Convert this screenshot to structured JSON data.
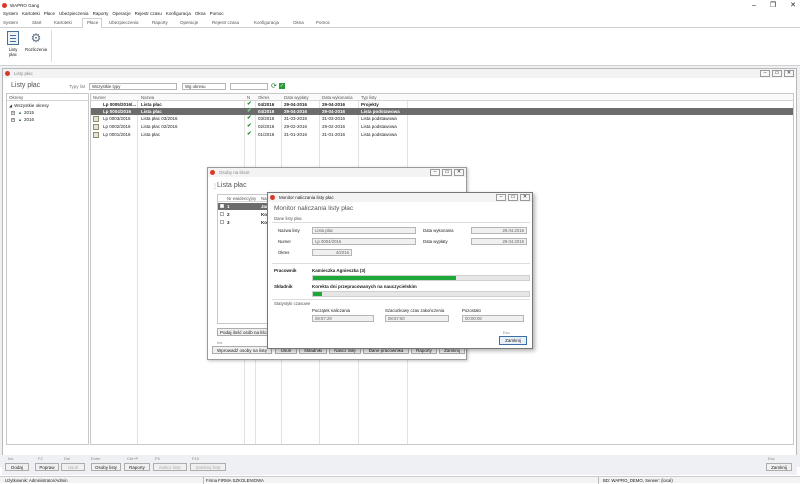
{
  "app": {
    "title": "WAPRO Gang"
  },
  "menubar": [
    "System",
    "Kartoteki",
    "Płace",
    "Ubezpieczenia",
    "Raporty",
    "Operacje",
    "Rejestr czasu",
    "Konfiguracja",
    "Okna",
    "Pomoc"
  ],
  "tabs": [
    "System",
    "Start",
    "Kartoteki",
    "Płace",
    "Ubezpieczenia",
    "Raporty",
    "Operacje",
    "Rejestr czasu",
    "Konfiguracja",
    "Okna",
    "Pomoc"
  ],
  "ribbon": {
    "btn1": "Listy płac",
    "btn2": "Rozliczenia"
  },
  "main_window": {
    "title": "Listy płac",
    "header": "Listy płac",
    "filter_label": "Typy list",
    "filter_type": "Wszystkie typy",
    "filter_period": "Wg okresu",
    "tree": {
      "header": "Okresy",
      "root": "Wszystkie okresy",
      "items": [
        "2015",
        "2016"
      ]
    },
    "table": {
      "headers": [
        "Numer",
        "Nazwa",
        "N",
        "Okres",
        "Data wypłaty",
        "Data wykonania",
        "Typ listy"
      ],
      "rows": [
        [
          "Lp 0005/2016/...",
          "Lista płac",
          "✔",
          "04/2016",
          "29-04-2016",
          "29-04-2016",
          "Projekty"
        ],
        [
          "Lp 0004/2016",
          "Lista płac",
          "✔",
          "04/2016",
          "29-04-2016",
          "29-04-2016",
          "Lista podstawowa"
        ],
        [
          "Lp 0003/2016",
          "Lista płac 03/2016",
          "✔",
          "03/2016",
          "31-03-2016",
          "31-03-2016",
          "Lista podstawowa"
        ],
        [
          "Lp 0002/2016",
          "Lista płac 02/2016",
          "✔",
          "02/2016",
          "29-02-2016",
          "29-02-2016",
          "Lista podstawowa"
        ],
        [
          "Lp 0001/2016",
          "Lista płac",
          "✔",
          "01/2016",
          "31-01-2016",
          "31-01-2016",
          "Lista podstawowa"
        ]
      ]
    }
  },
  "bottom_buttons": [
    {
      "key": "Ins",
      "label": "Dodaj"
    },
    {
      "key": "F2",
      "label": "Popraw"
    },
    {
      "key": "Del",
      "label": "Usuń"
    },
    {
      "key": "Enter",
      "label": "Osoby listy"
    },
    {
      "key": "Ctrl+P",
      "label": "Raporty"
    },
    {
      "key": "F5",
      "label": "Nalicz listę"
    },
    {
      "key": "F10",
      "label": "Zamknij listę"
    }
  ],
  "close_button": {
    "key": "Esc",
    "label": "Zamknij"
  },
  "statusbar": {
    "user": "Użytkownik: Administrator/Admin",
    "firm": "Firma FIRMA SZKOLENIOWA",
    "db": "BD: WAPRO_DEMO, Serwer: (local)"
  },
  "persons_window": {
    "title": "Osoby na liście",
    "header": "Lista płac",
    "col1": "Nr ewidencyjny",
    "col2": "Naz...",
    "rows": [
      [
        "1",
        "Jan..."
      ],
      [
        "2",
        "Ko..."
      ],
      [
        "3",
        "Kow..."
      ]
    ],
    "count_button": "Podaj ilość osób na liście",
    "hint": "Ins",
    "buttons": [
      "Wprowadź osoby na listę",
      "Usuń",
      "Składniki",
      "Nalicz listę",
      "Dane pracownika",
      "Raporty",
      "Zamknij"
    ]
  },
  "monitor": {
    "title": "Monitor naliczania listy płac",
    "header": "Monitor naliczania listy płac",
    "section1": "Dane listy płac",
    "name_label": "Nazwa listy",
    "name_value": "Lista płac",
    "number_label": "Numer",
    "number_value": "Lp 0004/2016",
    "period_label": "Okres",
    "period_value": "4/2016",
    "exec_label": "Data wykonania",
    "exec_value": "29.04.2016",
    "pay_label": "Data wypłaty",
    "pay_value": "29.04.2016",
    "worker_label": "Pracownik",
    "worker_value": "Kamieczka Agnieszka (3)",
    "worker_progress": 0.66,
    "component_label": "Składnik",
    "component_value": "Korekta dni przepracowanych na nauczycielskim",
    "component_progress": 0.04,
    "stats_label": "Statystyki czasowe",
    "start_label": "Początek naliczania",
    "start_value": "08:57:29",
    "eta_label": "Szacunkowy czas zakończenia",
    "eta_value": "08:57:50",
    "remaining_label": "Pozostało",
    "remaining_value": "00:00:06",
    "esc_hint": "Esc",
    "close_label": "Zamknij"
  },
  "colors": {
    "progress": "#1fa83a",
    "selected_row": "#6c6c6c",
    "close_red": "#d9372b"
  }
}
